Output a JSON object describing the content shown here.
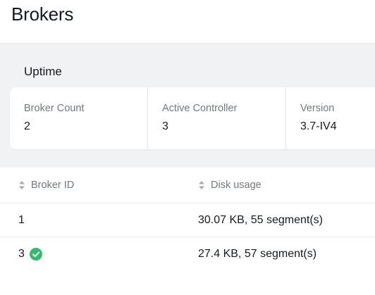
{
  "header": {
    "title": "Brokers"
  },
  "uptime": {
    "section_label": "Uptime",
    "metrics": [
      {
        "label": "Broker Count",
        "value": "2"
      },
      {
        "label": "Active Controller",
        "value": "3"
      },
      {
        "label": "Version",
        "value": "3.7-IV4"
      }
    ]
  },
  "table": {
    "columns": [
      {
        "label": "Broker ID",
        "icon": "sort-icon"
      },
      {
        "label": "Disk usage",
        "icon": "sort-icon"
      }
    ],
    "rows": [
      {
        "broker_id": "1",
        "disk_usage": "30.07 KB, 55 segment(s)",
        "controller_badge": false
      },
      {
        "broker_id": "3",
        "disk_usage": "27.4 KB, 57 segment(s)",
        "controller_badge": true,
        "badge_icon": "check-circle-icon"
      }
    ]
  },
  "colors": {
    "success": "#2fbe6a",
    "band_background": "#f1f2f3",
    "muted_text": "#73787e"
  }
}
